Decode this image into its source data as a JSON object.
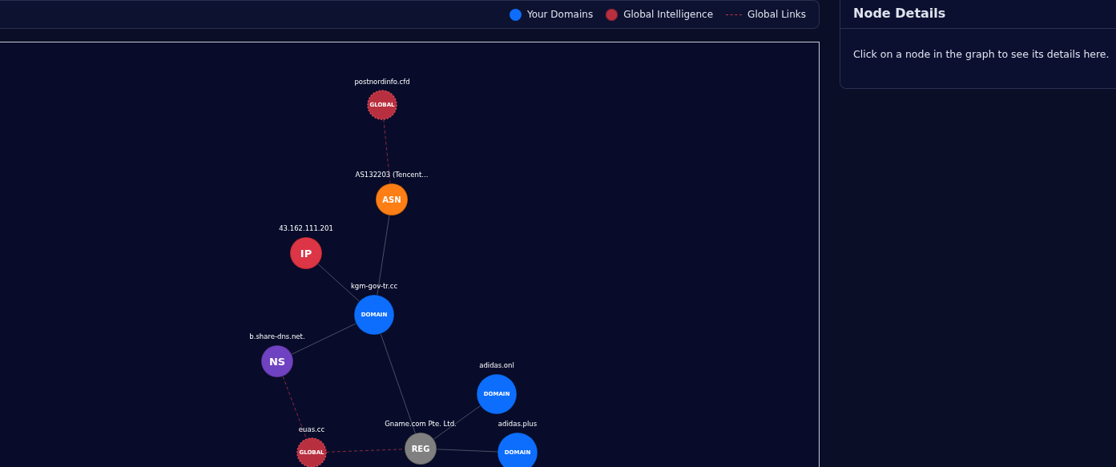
{
  "legend": [
    {
      "kind": "dot",
      "label": "Your Domains",
      "color": "#0d6efd"
    },
    {
      "kind": "blob",
      "label": "Global Intelligence",
      "color": "#b8303f"
    },
    {
      "kind": "dash",
      "label": "Global Links",
      "color": "#c0354a"
    }
  ],
  "graph": {
    "nodes": [
      {
        "label": "postnordinfo.cfd",
        "badge": "GLOBAL",
        "kind": "global",
        "color": "#b8303f"
      },
      {
        "label": "AS132203 (Tencent...",
        "badge": "ASN",
        "kind": "asn",
        "color": "#fd7e14"
      },
      {
        "label": "43.162.111.201",
        "badge": "IP",
        "kind": "ip",
        "color": "#dc3545"
      },
      {
        "label": "kgm-gov-tr.cc",
        "badge": "DOMAIN",
        "kind": "domain",
        "color": "#0d6efd"
      },
      {
        "label": "b.share-dns.net.",
        "badge": "NS",
        "kind": "ns",
        "color": "#6f42c1"
      },
      {
        "label": "adidas.onl",
        "badge": "DOMAIN",
        "kind": "domain",
        "color": "#0d6efd"
      },
      {
        "label": "euas.cc",
        "badge": "GLOBAL",
        "kind": "global",
        "color": "#b8303f"
      },
      {
        "label": "Gname.com Pte. Ltd.",
        "badge": "REG",
        "kind": "reg",
        "color": "#808080"
      },
      {
        "label": "adidas.plus",
        "badge": "DOMAIN",
        "kind": "domain",
        "color": "#0d6efd"
      }
    ]
  },
  "details": {
    "title": "Node Details",
    "message": "Click on a node in the graph to see its details here."
  }
}
